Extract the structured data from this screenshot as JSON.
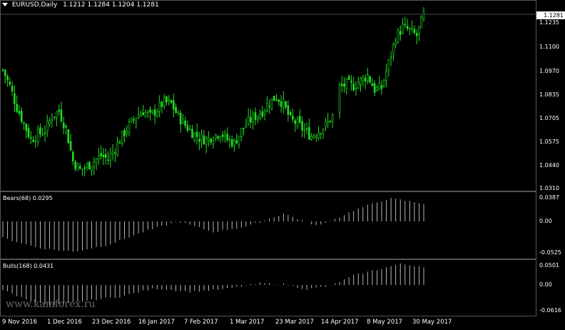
{
  "chart_header": {
    "symbol_tf": "EURUSD,Daily",
    "ohlc": "1.1212 1.1284 1.1204 1.1281"
  },
  "current_price": "1.1281",
  "price_axis": [
    "1.1235",
    "1.1100",
    "1.0970",
    "1.0835",
    "1.0705",
    "1.0575",
    "1.0440",
    "1.0310"
  ],
  "bears": {
    "label": "Bears(68) 0.0295",
    "axis": [
      "0.0387",
      "0.00",
      "-0.0525"
    ]
  },
  "bulls": {
    "label": "Bulls(168) 0.0431",
    "axis": [
      "0.0501",
      "0.00",
      "-0.0616"
    ]
  },
  "time_axis": [
    "9 Nov 2016",
    "1 Dec 2016",
    "23 Dec 2016",
    "16 Jan 2017",
    "7 Feb 2017",
    "1 Mar 2017",
    "23 Mar 2017",
    "14 Apr 2017",
    "8 May 2017",
    "30 May 2017"
  ],
  "watermark": "www.kamforex.ru",
  "colors": {
    "candle": "#22dd22",
    "histogram": "#c8c8c8",
    "background": "#000000",
    "text": "#ffffff"
  },
  "chart_data": [
    {
      "type": "candlestick",
      "title": "EURUSD,Daily",
      "ylim": [
        1.031,
        1.1281
      ],
      "close_path": [
        [
          0,
          1.097
        ],
        [
          3,
          1.088
        ],
        [
          6,
          1.076
        ],
        [
          9,
          1.067
        ],
        [
          12,
          1.058
        ],
        [
          15,
          1.061
        ],
        [
          18,
          1.063
        ],
        [
          21,
          1.071
        ],
        [
          24,
          1.074
        ],
        [
          27,
          1.064
        ],
        [
          30,
          1.046
        ],
        [
          33,
          1.041
        ],
        [
          36,
          1.043
        ],
        [
          39,
          1.046
        ],
        [
          42,
          1.049
        ],
        [
          45,
          1.047
        ],
        [
          48,
          1.053
        ],
        [
          51,
          1.06
        ],
        [
          54,
          1.066
        ],
        [
          57,
          1.071
        ],
        [
          60,
          1.074
        ],
        [
          63,
          1.071
        ],
        [
          66,
          1.075
        ],
        [
          69,
          1.079
        ],
        [
          72,
          1.078
        ],
        [
          75,
          1.071
        ],
        [
          78,
          1.066
        ],
        [
          81,
          1.062
        ],
        [
          84,
          1.059
        ],
        [
          87,
          1.058
        ],
        [
          90,
          1.06
        ],
        [
          93,
          1.062
        ],
        [
          96,
          1.058
        ],
        [
          99,
          1.056
        ],
        [
          102,
          1.063
        ],
        [
          105,
          1.068
        ],
        [
          108,
          1.071
        ],
        [
          111,
          1.074
        ],
        [
          114,
          1.079
        ],
        [
          117,
          1.082
        ],
        [
          120,
          1.078
        ],
        [
          123,
          1.069
        ],
        [
          126,
          1.067
        ],
        [
          129,
          1.063
        ],
        [
          132,
          1.06
        ],
        [
          135,
          1.063
        ],
        [
          138,
          1.066
        ],
        [
          141,
          1.071
        ],
        [
          144,
          1.087
        ],
        [
          147,
          1.089
        ],
        [
          150,
          1.088
        ],
        [
          153,
          1.091
        ],
        [
          156,
          1.094
        ],
        [
          159,
          1.086
        ],
        [
          162,
          1.087
        ],
        [
          165,
          1.101
        ],
        [
          168,
          1.115
        ],
        [
          171,
          1.121
        ],
        [
          174,
          1.119
        ],
        [
          177,
          1.116
        ],
        [
          180,
          1.128
        ]
      ],
      "gap_after_index": 141
    },
    {
      "type": "bar",
      "title": "Bears(68) 0.0295",
      "ylim": [
        -0.0525,
        0.0387
      ],
      "path": [
        [
          0,
          -0.028
        ],
        [
          15,
          -0.045
        ],
        [
          30,
          -0.052
        ],
        [
          45,
          -0.04
        ],
        [
          60,
          -0.018
        ],
        [
          75,
          0.0
        ],
        [
          90,
          -0.018
        ],
        [
          105,
          -0.008
        ],
        [
          120,
          0.013
        ],
        [
          135,
          -0.008
        ],
        [
          150,
          0.018
        ],
        [
          165,
          0.038
        ],
        [
          180,
          0.0295
        ]
      ]
    },
    {
      "type": "bar",
      "title": "Bulls(168) 0.0431",
      "ylim": [
        -0.0616,
        0.0501
      ],
      "path": [
        [
          0,
          -0.012
        ],
        [
          10,
          -0.034
        ],
        [
          20,
          -0.05
        ],
        [
          35,
          -0.038
        ],
        [
          50,
          -0.028
        ],
        [
          65,
          -0.008
        ],
        [
          80,
          -0.016
        ],
        [
          95,
          -0.01
        ],
        [
          110,
          0.004
        ],
        [
          120,
          0.002
        ],
        [
          130,
          -0.01
        ],
        [
          140,
          -0.002
        ],
        [
          150,
          0.022
        ],
        [
          160,
          0.036
        ],
        [
          170,
          0.049
        ],
        [
          180,
          0.0431
        ]
      ]
    }
  ]
}
